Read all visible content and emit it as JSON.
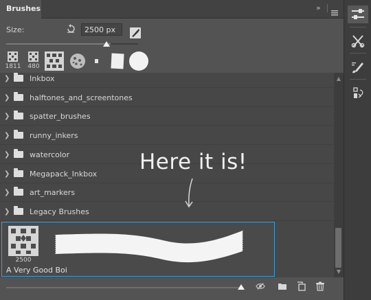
{
  "panel": {
    "tab_title": "Brushes",
    "collapse_label": "»",
    "menu_icon": "hamburger-menu-icon"
  },
  "size": {
    "label": "Size:",
    "value": "2500 px",
    "reset_icon": "reset-arrow-icon",
    "toggle_icon": "brush-settings-toggle-icon",
    "slider_fraction": 0.76
  },
  "recent_brushes": [
    {
      "num": "1811",
      "icon": "pattern-brush-icon"
    },
    {
      "num": "480",
      "icon": "pattern-brush-icon"
    },
    {
      "num": "",
      "icon": "pattern-brush-icon"
    },
    {
      "num": "",
      "icon": "spatter-brush-icon"
    },
    {
      "num": "",
      "icon": "small-square-brush-icon"
    },
    {
      "num": "",
      "icon": "square-brush-icon"
    },
    {
      "num": "",
      "icon": "round-brush-icon"
    }
  ],
  "folders": [
    "Inkbox",
    "halftones_and_screentones",
    "spatter_brushes",
    "runny_inkers",
    "watercolor",
    "Megapack_Inkbox",
    "art_markers",
    "Legacy Brushes"
  ],
  "annotation": "Here it is!",
  "selected_preset": {
    "num": "2500",
    "name": "A Very Good Boi",
    "icon": "pattern-brush-icon"
  },
  "bottom_icons": [
    "visibility-toggle-icon",
    "new-folder-icon",
    "new-brush-icon",
    "trash-icon"
  ],
  "dock_icons": [
    "adjustments-icon",
    "tools-icon",
    "brush-icon",
    "history-icon"
  ],
  "colors": {
    "panel_bg": "#535353",
    "list_bg": "#474747",
    "selection": "#38a0db"
  }
}
